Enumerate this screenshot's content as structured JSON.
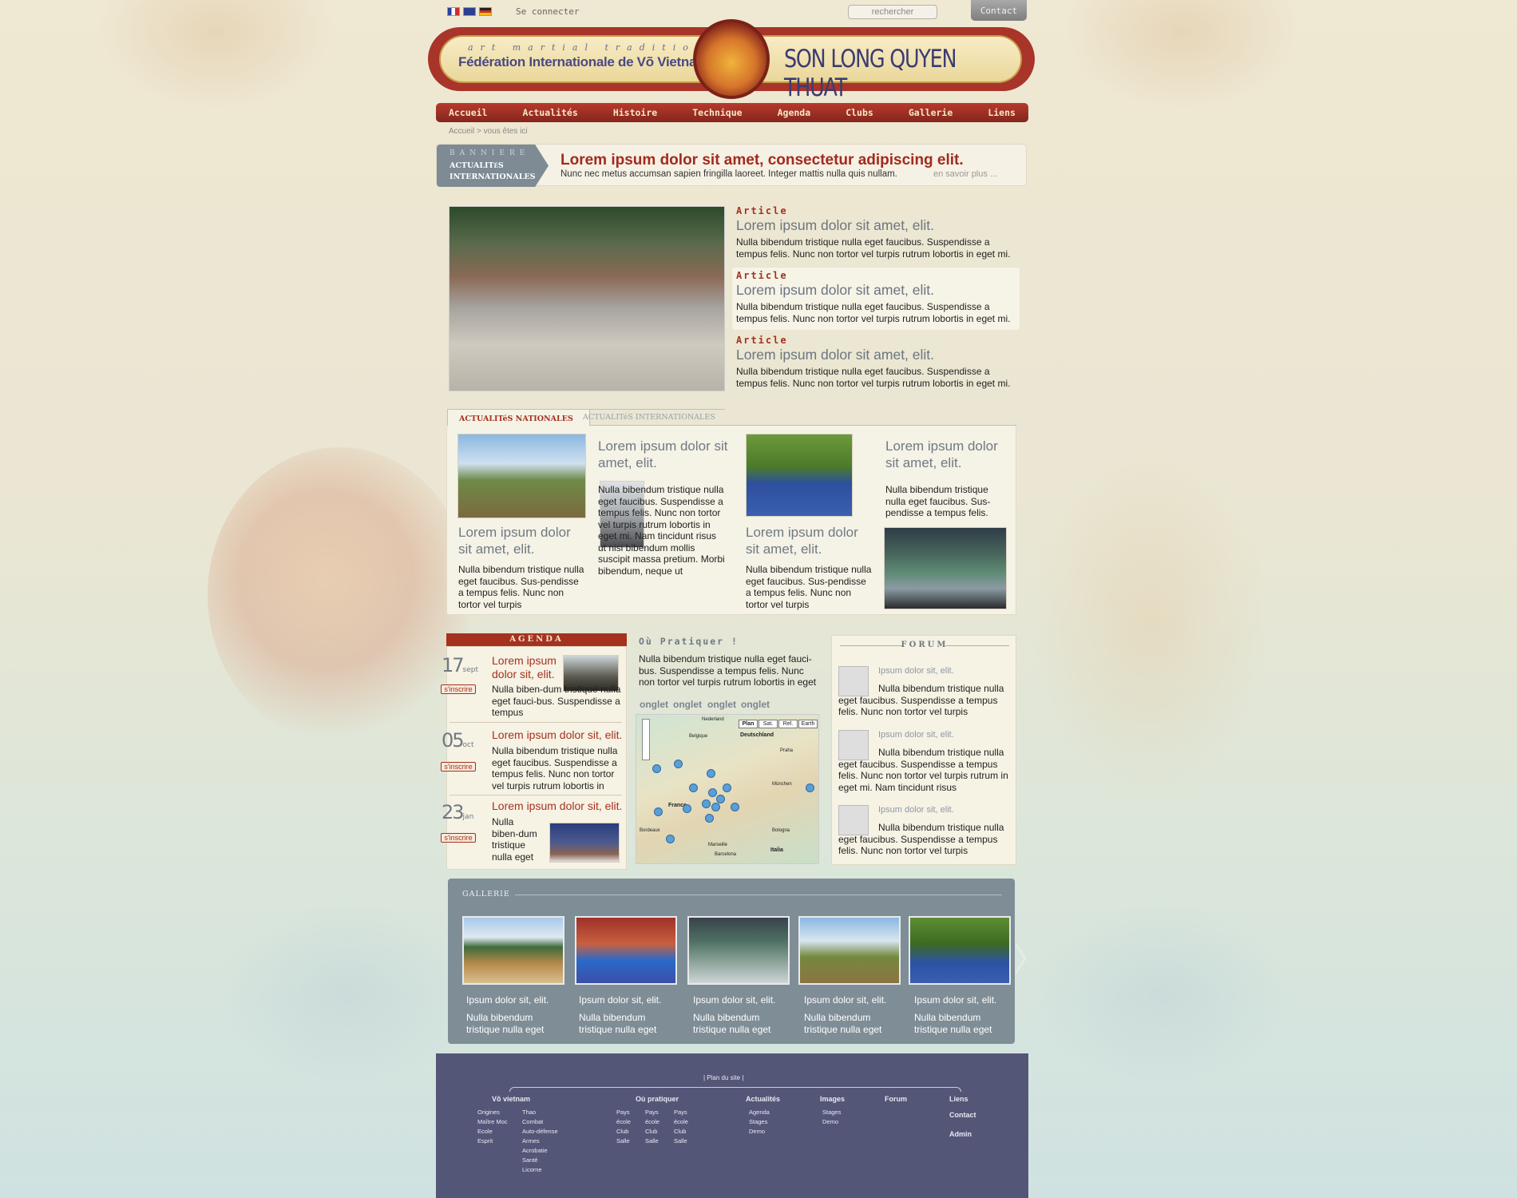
{
  "topbar": {
    "login": "Se connecter",
    "search_placeholder": "rechercher",
    "contact": "Contact",
    "flags": [
      "fr-flag-icon",
      "uk-flag-icon",
      "de-flag-icon"
    ]
  },
  "header": {
    "tagline": "art martial traditionnel",
    "federation": "Fédération Internationale de Võ Vietnam",
    "brand": "SON LONG QUYEN THUAT"
  },
  "nav": [
    "Accueil",
    "Actualités",
    "Histoire",
    "Technique",
    "Agenda",
    "Clubs",
    "Gallerie",
    "Liens"
  ],
  "breadcrumb": "Accueil > vous êtes ici",
  "banner": {
    "label1": "BANNIERE",
    "label2a": "ACTUALITéS",
    "label2b": "INTERNATIONALES",
    "title": "Lorem ipsum dolor sit amet, consectetur adipiscing elit.",
    "text": "Nunc nec metus accumsan sapien fringilla laoreet. Integer mattis nulla quis nullam.",
    "more": "en savoir plus ..."
  },
  "featured": [
    {
      "tag": "Article",
      "title": "Lorem ipsum dolor sit amet, elit.",
      "text": "Nulla bibendum tristique nulla eget faucibus. Suspendisse a tempus felis. Nunc non tortor vel turpis rutrum lobortis in eget mi."
    },
    {
      "tag": "Article",
      "title": "Lorem ipsum dolor sit amet, elit.",
      "text": "Nulla bibendum tristique nulla eget faucibus. Suspendisse a tempus felis. Nunc non tortor vel turpis rutrum lobortis in eget mi."
    },
    {
      "tag": "Article",
      "title": "Lorem ipsum dolor sit amet, elit.",
      "text": "Nulla bibendum tristique nulla eget faucibus. Suspendisse a tempus felis. Nunc non tortor vel turpis rutrum lobortis in eget mi."
    }
  ],
  "news": {
    "tab_active": "ACTUALITéS NATIONALES",
    "tab_inactive": "ACTUALITéS INTERNATIONALES",
    "items": [
      {
        "title": "Lorem ipsum dolor sit amet, elit.",
        "text": "Nulla bibendum tristique nulla eget faucibus. Sus-pendisse a tempus felis. Nunc non tortor vel turpis"
      },
      {
        "title": "Lorem ipsum dolor sit amet, elit.",
        "text": "Nulla bibendum tristique nulla eget faucibus. Suspendisse a tempus felis. Nunc non tortor vel turpis rutrum lobortis in eget mi. Nam tincidunt risus ut nisi bibendum mollis suscipit massa pretium. Morbi bibendum, neque ut"
      },
      {
        "title": "Lorem ipsum dolor sit amet, elit.",
        "text": "Nulla bibendum tristique nulla eget faucibus. Sus-pendisse a tempus felis. Nunc non tortor vel turpis"
      },
      {
        "title": "Lorem ipsum dolor sit amet, elit.",
        "text": "Nulla bibendum tristique nulla eget faucibus. Sus-pendisse a tempus felis."
      }
    ]
  },
  "agenda": {
    "title": "AGENDA",
    "register": "s'inscrire",
    "events": [
      {
        "day": "17",
        "month": "sept",
        "title": "Lorem ipsum dolor sit, elit.",
        "text": "Nulla biben-dum tristique nulla eget fauci-bus. Suspendisse a tempus"
      },
      {
        "day": "05",
        "month": "oct",
        "title": "Lorem ipsum dolor sit, elit.",
        "text": "Nulla bibendum tristique nulla eget faucibus. Suspendisse a tempus felis. Nunc non tortor vel turpis rutrum lobortis in"
      },
      {
        "day": "23",
        "month": "jan",
        "title": "Lorem ipsum dolor sit, elit.",
        "text": "Nulla biben-dum tristique nulla eget"
      }
    ]
  },
  "practice": {
    "title": "Où Pratiquer !",
    "text": "Nulla bibendum tristique nulla eget fauci-bus. Suspendisse a tempus felis. Nunc non tortor vel turpis rutrum lobortis in eget",
    "tabs": [
      "onglet",
      "onglet",
      "onglet",
      "onglet"
    ],
    "map_tabs": [
      "Plan",
      "Sat.",
      "Rel.",
      "Earth"
    ],
    "map_labels": [
      "Nederland",
      "Deutschland",
      "Belgique",
      "France",
      "Praha",
      "Italia",
      "Barcelona",
      "Bordeaux",
      "Marseille",
      "München",
      "Bologna"
    ]
  },
  "forum": {
    "title": "FORUM",
    "posts": [
      {
        "title": "Ipsum dolor sit, elit.",
        "text": "Nulla bibendum tristique nulla eget faucibus. Suspendisse a tempus felis. Nunc non tortor vel turpis"
      },
      {
        "title": "Ipsum dolor sit, elit.",
        "text": "Nulla bibendum tristique nulla eget faucibus. Suspendisse a tempus felis. Nunc non tortor vel turpis rutrum in eget mi. Nam tincidunt risus"
      },
      {
        "title": "Ipsum dolor sit, elit.",
        "text": "Nulla bibendum tristique nulla eget faucibus. Suspendisse a tempus felis. Nunc non tortor vel turpis"
      }
    ]
  },
  "gallery": {
    "title": "GALLERIE",
    "items": [
      {
        "title": "Ipsum dolor sit, elit.",
        "text": "Nulla bibendum tristique nulla eget"
      },
      {
        "title": "Ipsum dolor sit, elit.",
        "text": "Nulla bibendum tristique nulla eget"
      },
      {
        "title": "Ipsum dolor sit, elit.",
        "text": "Nulla bibendum tristique nulla eget"
      },
      {
        "title": "Ipsum dolor sit, elit.",
        "text": "Nulla bibendum tristique nulla eget"
      },
      {
        "title": "Ipsum dolor sit, elit.",
        "text": "Nulla bibendum tristique nulla eget"
      }
    ]
  },
  "footer": {
    "sitemap": "| Plan du site |",
    "vo": {
      "head": "Võ vietnam",
      "col1": [
        "Origines",
        "Maître Moc",
        "Ecole",
        "Esprit"
      ],
      "col2": [
        "Thao",
        "Combat",
        "Auto-défense",
        "Armes",
        "Acrobatie",
        "Santé",
        "Licorne"
      ]
    },
    "ou": {
      "head": "Où pratiquer",
      "col1": [
        "Pays",
        "école",
        "Club",
        "Salle"
      ],
      "col2": [
        "Pays",
        "école",
        "Club",
        "Salle"
      ],
      "col3": [
        "Pays",
        "école",
        "Club",
        "Salle"
      ]
    },
    "actu": {
      "head": "Actualités",
      "items": [
        "Agenda",
        "Stages",
        "Demo"
      ]
    },
    "images": {
      "head": "Images",
      "items": [
        "Stages",
        "Demo"
      ]
    },
    "forum": "Forum",
    "liens": "Liens",
    "contact": "Contact",
    "admin": "Admin"
  },
  "colors": {
    "accent_red": "#a5321f",
    "nav_red": "#b8392c",
    "gallery_bg": "#7f8d96",
    "footer_bg": "#535677"
  }
}
